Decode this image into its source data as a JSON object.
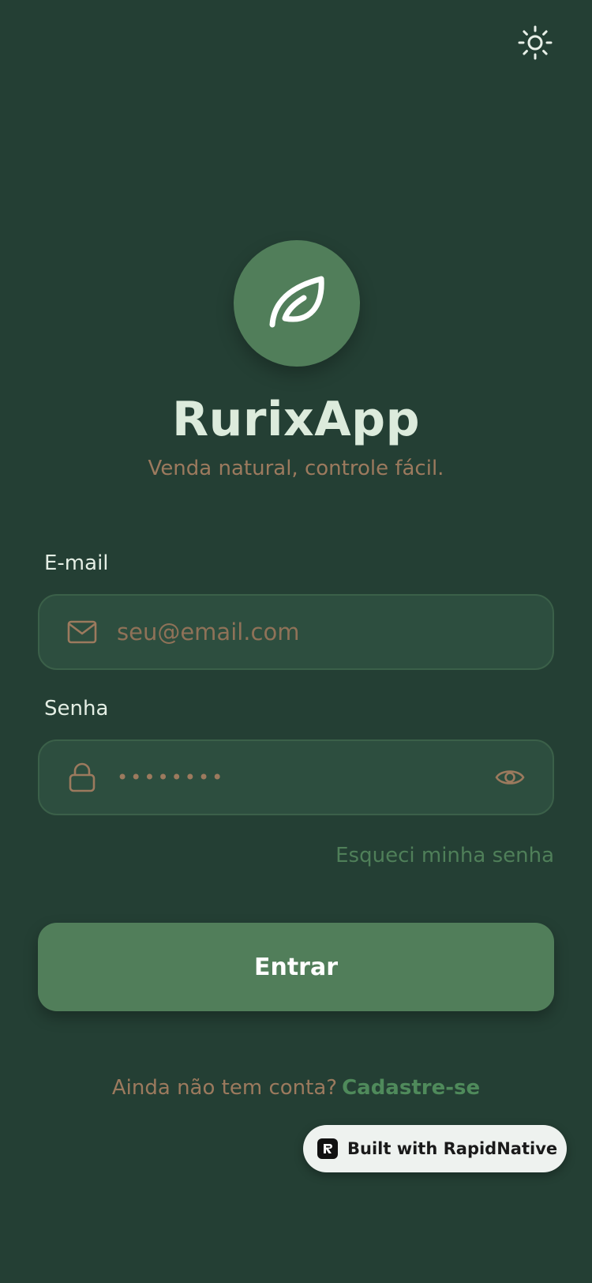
{
  "app": {
    "name": "RurixApp",
    "tagline": "Venda natural, controle fácil."
  },
  "header": {
    "theme_icon": "sun-icon"
  },
  "logo": {
    "icon": "leaf-icon",
    "circle_color": "#517e5a"
  },
  "form": {
    "email": {
      "label": "E-mail",
      "placeholder": "seu@email.com",
      "icon": "mail-icon"
    },
    "password": {
      "label": "Senha",
      "value": "••••••••",
      "icon": "lock-icon",
      "toggle_icon": "eye-icon"
    },
    "forgot_label": "Esqueci minha senha",
    "submit_label": "Entrar"
  },
  "signup": {
    "prompt": "Ainda não tem conta?",
    "link_label": "Cadastre-se"
  },
  "badge": {
    "label": "Built with RapidNative",
    "icon": "rapidnative-logo-icon"
  },
  "colors": {
    "background": "#243f34",
    "accent": "#517e5a",
    "input_bg": "#2d4e3f",
    "muted_text": "#9c7a5e",
    "title": "#dcebdc"
  }
}
